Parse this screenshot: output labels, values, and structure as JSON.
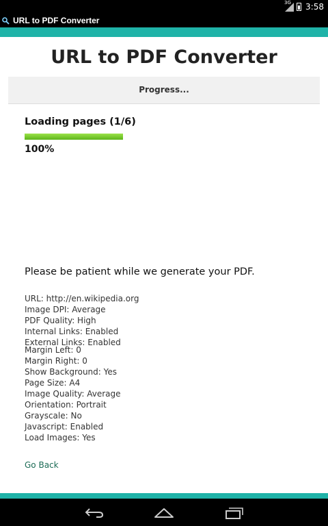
{
  "status_bar": {
    "time": "3:58",
    "network": "3G"
  },
  "app_bar": {
    "title": "URL to PDF Converter"
  },
  "main": {
    "title": "URL to PDF Converter",
    "banner": "Progress...",
    "loading_label": "Loading pages (1/6)",
    "progress_percent": 100,
    "percent_label": "100%",
    "patient_message": "Please be patient while we generate your PDF.",
    "settings": [
      "URL: http://en.wikipedia.org",
      "Image DPI: Average",
      "PDF Quality: High",
      "Internal Links: Enabled",
      "External Links: Enabled",
      "Margin Left: 0",
      "Margin Right: 0",
      "Show Background: Yes",
      "Page Size: A4",
      "Image Quality: Average",
      "Orientation: Portrait",
      "Grayscale: No",
      "Javascript: Enabled",
      "Load Images: Yes"
    ],
    "go_back": "Go Back"
  },
  "colors": {
    "accent": "#1fb3a8",
    "progress": "#6cc425",
    "link": "#1b6b55"
  },
  "icons": {
    "app": "magnifier-icon",
    "signal": "signal-icon",
    "battery": "battery-icon",
    "nav_back": "back-arrow-icon",
    "nav_home": "home-icon",
    "nav_recents": "recents-icon"
  }
}
